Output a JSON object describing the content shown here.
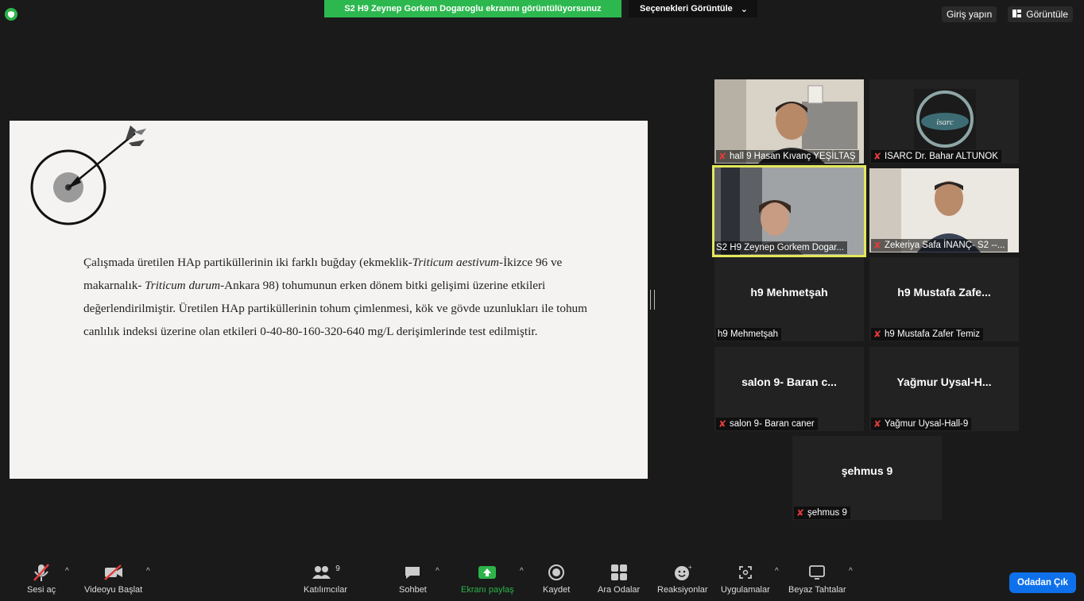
{
  "banner": {
    "sharing_text": "S2 H9 Zeynep Gorkem Dogaroglu ekranını görüntülüyorsunuz",
    "view_options": "Seçenekleri Görüntüle"
  },
  "top_right": {
    "login": "Giriş yapın",
    "view": "Görüntüle"
  },
  "slide": {
    "lines": [
      "Çalışmada üretilen HAp partiküllerinin iki farklı buğday (ekmeklik-",
      "Triticum aestivum",
      "-İkizce 96 ve makarnalık- ",
      "Triticum durum",
      "-Ankara 98) tohumunun erken dönem bitki gelişimi üzerine etkileri değerlendirilmiştir. Üretilen HAp partiküllerinin tohum çimlenmesi, kök ve gövde uzunlukları ile tohum canlılık indeksi üzerine olan etkileri 0-40-80-160-320-640 mg/L derişimlerinde test edilmiştir."
    ]
  },
  "participants": [
    {
      "label": "hall 9 Hasan Kıvanç YEŞİLTAŞ",
      "muted": true,
      "video": true
    },
    {
      "label": "ISARC Dr. Bahar ALTUNOK",
      "muted": true,
      "video": true
    },
    {
      "label": "S2 H9 Zeynep Gorkem Dogar...",
      "muted": false,
      "video": true,
      "active": true
    },
    {
      "label": "Zekeriya Safa İNANÇ- S2 --...",
      "muted": true,
      "video": true
    },
    {
      "label": "h9 Mehmetşah",
      "big": "h9 Mehmetşah",
      "muted": false
    },
    {
      "label": "h9 Mustafa Zafer Temiz",
      "big": "h9 Mustafa Zafe...",
      "muted": true
    },
    {
      "label": "salon 9- Baran caner",
      "big": "salon 9- Baran c...",
      "muted": true
    },
    {
      "label": "Yağmur Uysal-Hall-9",
      "big": "Yağmur Uysal-H...",
      "muted": true
    },
    {
      "label": "şehmus 9",
      "big": "şehmus 9",
      "muted": true
    }
  ],
  "toolbar": {
    "unmute": "Sesi aç",
    "start_video": "Videoyu Başlat",
    "participants": "Katılımcılar",
    "participants_count": "9",
    "chat": "Sohbet",
    "share_screen": "Ekranı paylaş",
    "record": "Kaydet",
    "breakout": "Ara Odalar",
    "reactions": "Reaksiyonlar",
    "apps": "Uygulamalar",
    "whiteboards": "Beyaz Tahtalar",
    "leave": "Odadan Çık"
  },
  "colors": {
    "share_green": "#2cb84f",
    "leave_blue": "#0e71eb",
    "active_border": "#e4e85a",
    "muted_red": "#e23b3b"
  }
}
